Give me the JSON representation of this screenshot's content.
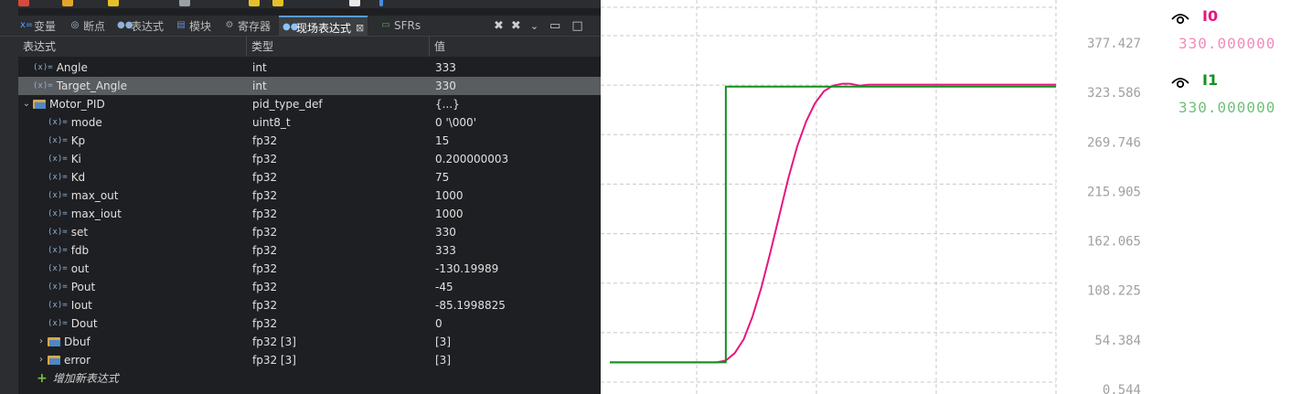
{
  "tabs": [
    {
      "name": "variables",
      "label": "变量",
      "icon": "variables-icon"
    },
    {
      "name": "breakpoints",
      "label": "断点",
      "icon": "breakpoints-icon"
    },
    {
      "name": "expressions",
      "label": "表达式",
      "icon": "expressions-icon"
    },
    {
      "name": "modules",
      "label": "模块",
      "icon": "modules-icon"
    },
    {
      "name": "registers",
      "label": "寄存器",
      "icon": "registers-icon"
    },
    {
      "name": "live-expressions",
      "label": "现场表达式",
      "icon": "live-expressions-icon",
      "active": true
    },
    {
      "name": "sfrs",
      "label": "SFRs",
      "icon": "sfrs-icon"
    }
  ],
  "columns": {
    "expression": "表达式",
    "type": "类型",
    "value": "值"
  },
  "rows": [
    {
      "name": "Angle",
      "type": "int",
      "value": "333",
      "level": 0,
      "kind": "var"
    },
    {
      "name": "Target_Angle",
      "type": "int",
      "value": "330",
      "level": 0,
      "kind": "var",
      "selected": true
    },
    {
      "name": "Motor_PID",
      "type": "pid_type_def",
      "value": "{...}",
      "level": 0,
      "kind": "struct",
      "expanded": true
    },
    {
      "name": "mode",
      "type": "uint8_t",
      "value": "0 '\\000'",
      "level": 1,
      "kind": "var"
    },
    {
      "name": "Kp",
      "type": "fp32",
      "value": "15",
      "level": 1,
      "kind": "var"
    },
    {
      "name": "Ki",
      "type": "fp32",
      "value": "0.200000003",
      "level": 1,
      "kind": "var"
    },
    {
      "name": "Kd",
      "type": "fp32",
      "value": "75",
      "level": 1,
      "kind": "var"
    },
    {
      "name": "max_out",
      "type": "fp32",
      "value": "1000",
      "level": 1,
      "kind": "var"
    },
    {
      "name": "max_iout",
      "type": "fp32",
      "value": "1000",
      "level": 1,
      "kind": "var"
    },
    {
      "name": "set",
      "type": "fp32",
      "value": "330",
      "level": 1,
      "kind": "var"
    },
    {
      "name": "fdb",
      "type": "fp32",
      "value": "333",
      "level": 1,
      "kind": "var"
    },
    {
      "name": "out",
      "type": "fp32",
      "value": "-130.19989",
      "level": 1,
      "kind": "var"
    },
    {
      "name": "Pout",
      "type": "fp32",
      "value": "-45",
      "level": 1,
      "kind": "var"
    },
    {
      "name": "Iout",
      "type": "fp32",
      "value": "-85.1998825",
      "level": 1,
      "kind": "var"
    },
    {
      "name": "Dout",
      "type": "fp32",
      "value": "0",
      "level": 1,
      "kind": "var"
    },
    {
      "name": "Dbuf",
      "type": "fp32 [3]",
      "value": "[3]",
      "level": 1,
      "kind": "array"
    },
    {
      "name": "error",
      "type": "fp32 [3]",
      "value": "[3]",
      "level": 1,
      "kind": "array"
    }
  ],
  "add_expression_label": "增加新表达式",
  "chart_data": {
    "type": "line",
    "yticks": [
      "377.427",
      "323.586",
      "269.746",
      "215.905",
      "162.065",
      "108.225",
      "54.384",
      "0.544"
    ],
    "ylim": [
      0.544,
      377.427
    ],
    "x": [
      0,
      10,
      20,
      30,
      40,
      50,
      60,
      70,
      80,
      90,
      100,
      110,
      120,
      130,
      140,
      150,
      160,
      170,
      180,
      190,
      200,
      210,
      220,
      230,
      240,
      250,
      260,
      270,
      280,
      290,
      300,
      310,
      320,
      330,
      340,
      350,
      360,
      370,
      380,
      390,
      400,
      410,
      420,
      430,
      440,
      450,
      460,
      470,
      480,
      490,
      500
    ],
    "series": [
      {
        "name": "I0",
        "color": "#e6157f",
        "values": [
          30,
          30,
          30,
          30,
          30,
          30,
          30,
          30,
          30,
          30,
          30,
          30,
          30,
          32,
          40,
          55,
          80,
          112,
          150,
          190,
          230,
          265,
          292,
          312,
          325,
          331,
          333,
          333,
          331,
          332,
          332,
          332,
          332,
          332,
          332,
          332,
          332,
          332,
          332,
          332,
          332,
          332,
          332,
          332,
          332,
          332,
          332,
          332,
          332,
          332,
          332
        ]
      },
      {
        "name": "I1",
        "color": "#14901e",
        "values": [
          30,
          30,
          30,
          30,
          30,
          30,
          30,
          30,
          30,
          30,
          30,
          30,
          30,
          330,
          330,
          330,
          330,
          330,
          330,
          330,
          330,
          330,
          330,
          330,
          330,
          330,
          330,
          330,
          330,
          330,
          330,
          330,
          330,
          330,
          330,
          330,
          330,
          330,
          330,
          330,
          330,
          330,
          330,
          330,
          330,
          330,
          330,
          330,
          330,
          330,
          330
        ]
      }
    ]
  },
  "legend": [
    {
      "name": "I0",
      "value": "330.000000",
      "color": "#e6157f",
      "value_color": "#f08cbc"
    },
    {
      "name": "I1",
      "value": "330.000000",
      "color": "#14901e",
      "value_color": "#6fc07a"
    }
  ]
}
